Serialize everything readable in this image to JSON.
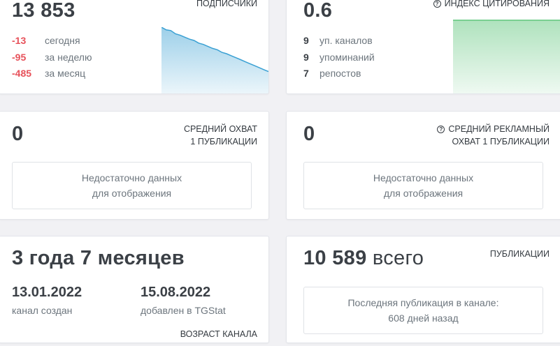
{
  "subscribers": {
    "value": "13 853",
    "label": "ПОДПИСЧИКИ",
    "stats": [
      {
        "num": "-13",
        "text": "сегодня"
      },
      {
        "num": "-95",
        "text": "за неделю"
      },
      {
        "num": "-485",
        "text": "за месяц"
      }
    ],
    "chart_color": "#3aa0d3",
    "chart_data": {
      "type": "area",
      "values": [
        100,
        96,
        95,
        90,
        88,
        85,
        82,
        80,
        76,
        74,
        71,
        68,
        66,
        62,
        60,
        57,
        54,
        51,
        48,
        45,
        42,
        39,
        36,
        33
      ]
    }
  },
  "citation": {
    "value": "0.6",
    "label": "ИНДЕКС ЦИТИРОВАНИЯ",
    "icon": "question-circle-icon",
    "stats": [
      {
        "num": "9",
        "text": "уп. каналов"
      },
      {
        "num": "9",
        "text": "упоминаний"
      },
      {
        "num": "7",
        "text": "репостов"
      }
    ],
    "chart_color": "#5ec57b",
    "chart_data": {
      "type": "area",
      "values": [
        1,
        1
      ]
    }
  },
  "avg_reach": {
    "value": "0",
    "label_line1": "СРЕДНИЙ ОХВАТ",
    "label_line2": "1 ПУБЛИКАЦИИ",
    "nodata_line1": "Недостаточно данных",
    "nodata_line2": "для отображения"
  },
  "avg_ad_reach": {
    "value": "0",
    "icon": "question-circle-icon",
    "label_line1": "СРЕДНИЙ РЕКЛАМНЫЙ",
    "label_line2": "ОХВАТ 1 ПУБЛИКАЦИИ",
    "nodata_line1": "Недостаточно данных",
    "nodata_line2": "для отображения"
  },
  "channel_age": {
    "value": "3 года 7 месяцев",
    "created_date": "13.01.2022",
    "created_label": "канал создан",
    "added_date": "15.08.2022",
    "added_label": "добавлен в TGStat",
    "label": "ВОЗРАСТ КАНАЛА"
  },
  "publications": {
    "value_num": "10 589",
    "value_suffix": "всего",
    "label": "ПУБЛИКАЦИИ",
    "last_line1": "Последняя публикация в канале:",
    "last_line2": "608 дней назад"
  }
}
